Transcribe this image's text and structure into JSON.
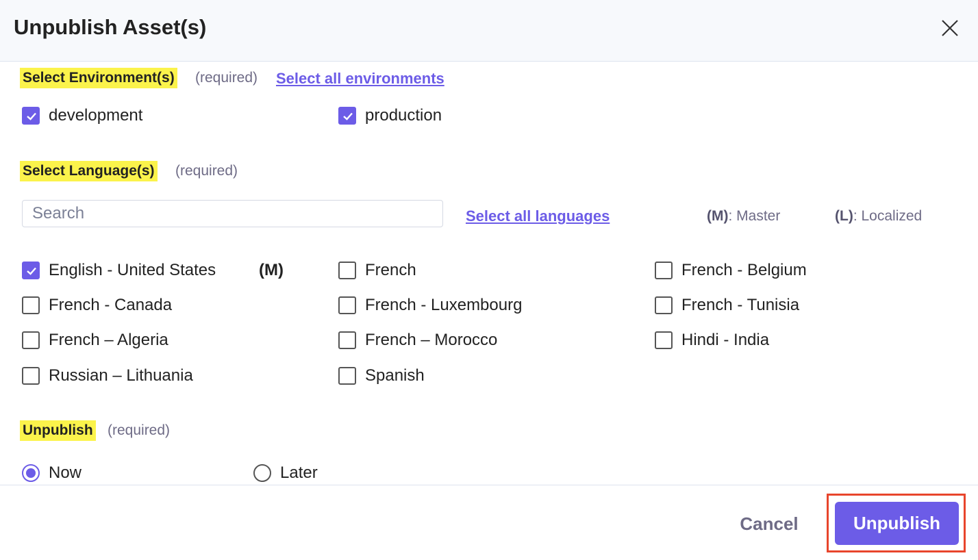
{
  "dialog": {
    "title": "Unpublish Asset(s)",
    "close_icon": "close-icon"
  },
  "environments": {
    "label": "Select Environment(s)",
    "required": "(required)",
    "select_all": "Select all environments",
    "options": [
      {
        "label": "development",
        "checked": true
      },
      {
        "label": "production",
        "checked": true
      }
    ]
  },
  "languages": {
    "label": "Select Language(s)",
    "required": "(required)",
    "search_placeholder": "Search",
    "search_value": "",
    "select_all": "Select all languages",
    "legend": {
      "master_key": "(M)",
      "master_text": ": Master",
      "localized_key": "(L)",
      "localized_text": ": Localized"
    },
    "master_tag": "(M)",
    "options": [
      {
        "label": "English - United States",
        "checked": true
      },
      {
        "label": "French",
        "checked": false
      },
      {
        "label": "French - Belgium",
        "checked": false
      },
      {
        "label": "French - Canada",
        "checked": false
      },
      {
        "label": "French - Luxembourg",
        "checked": false
      },
      {
        "label": "French - Tunisia",
        "checked": false
      },
      {
        "label": "French – Algeria",
        "checked": false
      },
      {
        "label": "French – Morocco",
        "checked": false
      },
      {
        "label": "Hindi - India",
        "checked": false
      },
      {
        "label": "Russian – Lithuania",
        "checked": false
      },
      {
        "label": "Spanish",
        "checked": false
      }
    ]
  },
  "unpublish": {
    "label": "Unpublish",
    "required": "(required)",
    "options": [
      {
        "label": "Now",
        "selected": true
      },
      {
        "label": "Later",
        "selected": false
      }
    ]
  },
  "footer": {
    "cancel_label": "Cancel",
    "unpublish_label": "Unpublish"
  },
  "colors": {
    "accent": "#6c5ce7",
    "highlight": "#fbf34b",
    "focus_outline": "#e8452c"
  }
}
